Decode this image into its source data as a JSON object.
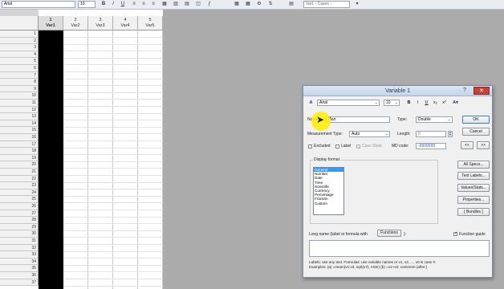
{
  "toolbar": {
    "font": "Arial",
    "size": "10",
    "bold": "B",
    "italic": "I",
    "underline": "U",
    "var_field": "Var1 - Cases -"
  },
  "sheet": {
    "columns": [
      {
        "num": "1",
        "name": "Var1"
      },
      {
        "num": "2",
        "name": "Var2"
      },
      {
        "num": "3",
        "name": "Var3"
      },
      {
        "num": "4",
        "name": "Var4"
      },
      {
        "num": "5",
        "name": "Var5"
      }
    ],
    "rows": [
      "1",
      "2",
      "3",
      "4",
      "5",
      "6",
      "7",
      "8",
      "9",
      "10",
      "11",
      "12",
      "13",
      "14",
      "15",
      "16",
      "17",
      "18",
      "19",
      "20",
      "21",
      "22",
      "23",
      "24",
      "25",
      "26",
      "27",
      "28",
      "29",
      "30",
      "31",
      "32",
      "33",
      "34",
      "35",
      "36",
      "37"
    ]
  },
  "dialog": {
    "title": "Variable 1",
    "help": "?",
    "close": "✕",
    "font": "Arial",
    "font_size": "10",
    "bold": "B",
    "italic": "I",
    "underline": "U",
    "name_label": "Name:",
    "name_value": "Пол",
    "type_label": "Type:",
    "type_value": "Double",
    "ok": "OK",
    "measurement_label": "Measurement Type:",
    "measurement_value": "Auto",
    "length_label": "Length:",
    "length_value": "8",
    "cancel": "Cancel",
    "excluded": "Excluded",
    "label": "Label",
    "case_state": "Case State",
    "md_code_label": "MD code:",
    "md_code_value": "-9999999",
    "nav_prev": "<<",
    "nav_next": ">>",
    "display_format": "Display format",
    "formats": [
      "General",
      "Number",
      "Date",
      "Time",
      "Scientific",
      "Currency",
      "Percentage",
      "Fraction",
      "Custom"
    ],
    "all_specs": "All Specs...",
    "text_labels": "Text Labels...",
    "values_stats": "Values/Stats...",
    "properties": "Properties...",
    "bundles": "[ Bundles ]",
    "long_name_label": "Long name (label or formula with",
    "functions": "Functions",
    "long_name_suffix": "):",
    "function_guide": "Function guide",
    "hint_line1": "Labels: use any text. Formulas: use variable names or v1, v2, ..., v0 is case #.",
    "hint_line2": "Examples: (a) =mean(v1:v3, sqrt(v7), AGE) (b) =v1+v2; comment (after;)"
  }
}
